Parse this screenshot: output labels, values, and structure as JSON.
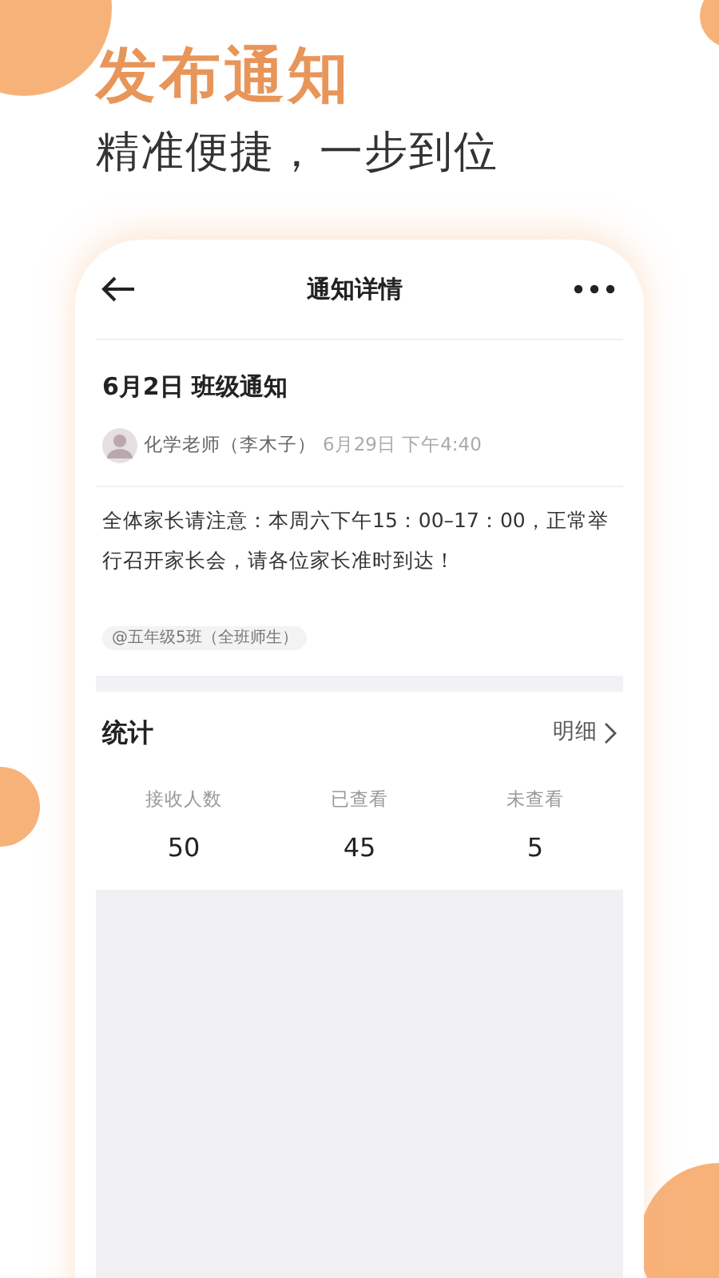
{
  "promo": {
    "headline": "发布通知",
    "subtitle": "精准便捷，一步到位"
  },
  "screen": {
    "title": "通知详情",
    "notice": {
      "title": "6月2日 班级通知",
      "author": "化学老师（李木子）",
      "time": "6月29日 下午4:40",
      "body": "全体家长请注意：本周六下午15：00–17：00，正常举行召开家长会，请各位家长准时到达！",
      "audience": "@五年级5班（全班师生）"
    },
    "stats": {
      "title": "统计",
      "detail_link": "明细",
      "items": [
        {
          "label": "接收人数",
          "value": "50"
        },
        {
          "label": "已查看",
          "value": "45"
        },
        {
          "label": "未查看",
          "value": "5"
        }
      ]
    }
  }
}
